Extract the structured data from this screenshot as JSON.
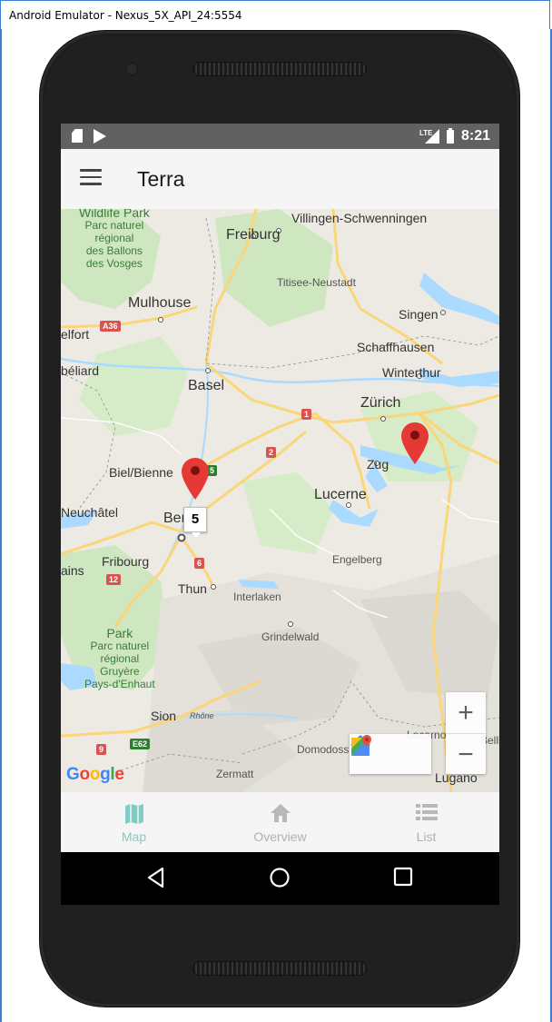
{
  "window": {
    "title": "Android Emulator - Nexus_5X_API_24:5554"
  },
  "status_bar": {
    "time": "8:21",
    "network": "LTE"
  },
  "app_bar": {
    "title": "Terra"
  },
  "map": {
    "places": {
      "villingen": "Villingen-Schwenningen",
      "freiburg": "Freiburg",
      "titisee": "Titisee-Neustadt",
      "mulhouse": "Mulhouse",
      "belfort": "elfort",
      "singen": "Singen",
      "schaffhausen": "Schaffhausen",
      "montbeliard": "béliard",
      "basel": "Basel",
      "winterthur": "Winterthur",
      "zurich": "Zürich",
      "zug": "Zug",
      "biel": "Biel/Bienne",
      "lucerne": "Lucerne",
      "neuchatel": "Neuchâtel",
      "bern": "Bern",
      "fribourg": "Fribourg",
      "engelberg": "Engelberg",
      "plains": "ains",
      "thun": "Thun",
      "interlaken": "Interlaken",
      "grindelwald": "Grindelwald",
      "sion": "Sion",
      "rhone": "Rhône",
      "locarno": "Locarno",
      "bellinzona": "Belli",
      "domodossola": "Domodoss",
      "lugano": "Lugano",
      "zermatt": "Zermatt"
    },
    "parks": {
      "vosges_title": "Wildlife Park",
      "vosges_lines": [
        "Parc naturel",
        "régional",
        "des Ballons",
        "des Vosges"
      ],
      "gruyere_title": "Park",
      "gruyere_lines": [
        "Parc naturel",
        "régional",
        "Gruyère",
        "Pays-d'Enhaut"
      ]
    },
    "road_badges": [
      "A36",
      "1",
      "2",
      "5",
      "6",
      "12",
      "9",
      "E62"
    ],
    "cluster_count": "5",
    "zoom_in": "+",
    "zoom_out": "−",
    "attribution": {
      "G1": "G",
      "o1": "o",
      "o2": "o",
      "g": "g",
      "l": "l",
      "e": "e"
    },
    "colors": {
      "pin": "#e53935",
      "water": "#aadaff",
      "park": "#cde8c1",
      "road": "#fbd679"
    }
  },
  "bottom_nav": {
    "items": [
      {
        "label": "Map",
        "icon": "map-icon",
        "active": true
      },
      {
        "label": "Overview",
        "icon": "home-icon",
        "active": false
      },
      {
        "label": "List",
        "icon": "list-icon",
        "active": false
      }
    ],
    "accent": "#80cbc4"
  }
}
